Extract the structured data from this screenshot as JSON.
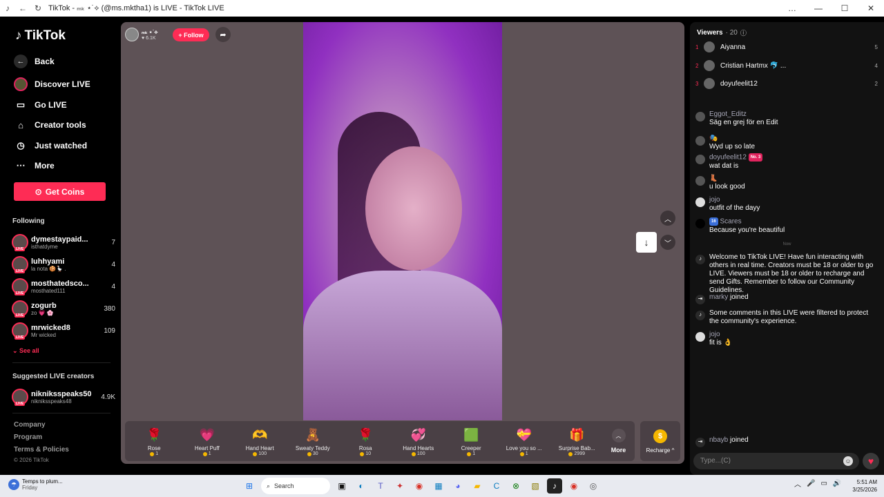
{
  "window": {
    "title": "TikTok - ₘₖ ⋆˙⟡ (@ms.mktha1) is LIVE - TikTok LIVE",
    "controls": [
      "…",
      "—",
      "☐",
      "✕"
    ]
  },
  "sidebar": {
    "logo_text": "TikTok",
    "back_label": "Back",
    "nav": [
      {
        "label": "Discover LIVE",
        "icon": "avatar-live-icon"
      },
      {
        "label": "Go LIVE",
        "icon": "camera-icon"
      },
      {
        "label": "Creator tools",
        "icon": "house-icon"
      },
      {
        "label": "Just watched",
        "icon": "clock-icon"
      },
      {
        "label": "More",
        "icon": "more-dots-icon"
      }
    ],
    "coins_label": "Get Coins",
    "following_title": "Following",
    "following": [
      {
        "name": "dymestaypaid...",
        "sub": "isthatdyme",
        "count": "7"
      },
      {
        "name": "luhhyami",
        "sub": "la nota 🍪🪿 .",
        "count": "4"
      },
      {
        "name": "mosthatedsco...",
        "sub": "mosthated111",
        "count": "4"
      },
      {
        "name": "zogurb",
        "sub": "zo 💗 🌸",
        "count": "380"
      },
      {
        "name": "mrwicked8",
        "sub": "Mr wicked",
        "count": "109"
      }
    ],
    "see_all": "See all",
    "suggested_title": "Suggested LIVE creators",
    "suggested": [
      {
        "name": "nikniksspeaks50",
        "sub": "nikniksspeaks48",
        "count": "4.9K"
      }
    ],
    "footer_links": [
      "Company",
      "Program",
      "Terms & Policies"
    ],
    "copyright": "© 2026 TikTok"
  },
  "stage": {
    "host_name": "ₘₖ ⋆˙⟡",
    "host_likes": "♥ 6.1K",
    "follow_label": "+ Follow",
    "gifts": [
      {
        "name": "Rose",
        "price": "1",
        "emoji": "🌹"
      },
      {
        "name": "Heart Puff",
        "price": "1",
        "emoji": "💗"
      },
      {
        "name": "Hand Heart",
        "price": "100",
        "emoji": "🫶"
      },
      {
        "name": "Sweaty Teddy",
        "price": "30",
        "emoji": "🧸"
      },
      {
        "name": "Rosa",
        "price": "10",
        "emoji": "🌹"
      },
      {
        "name": "Hand Hearts",
        "price": "100",
        "emoji": "💞"
      },
      {
        "name": "Creeper",
        "price": "1",
        "emoji": "🟩"
      },
      {
        "name": "Love you so ...",
        "price": "1",
        "emoji": "💝"
      },
      {
        "name": "Surprise Bab...",
        "price": "2999",
        "emoji": "🎁"
      }
    ],
    "more_label": "More",
    "recharge_label": "Recharge ^"
  },
  "chat": {
    "viewers_title": "Viewers",
    "viewers_count": "· 20",
    "viewers": [
      {
        "rank": "1",
        "name": "Aiyanna",
        "score": "5"
      },
      {
        "rank": "2",
        "name": "Cristian Hartmx 🐬 ...",
        "score": "4"
      },
      {
        "rank": "3",
        "name": "doyufeelit12",
        "score": "2"
      }
    ],
    "messages": [
      {
        "user": "Eggot_Editz",
        "text": "Säg en grej för en Edit"
      },
      {
        "user": "🎭",
        "text": "Wyd up so late"
      },
      {
        "user": "doyufeelit12",
        "badge": "No. 3",
        "text": "wat dat is"
      },
      {
        "user": "👢",
        "text": "u look good"
      },
      {
        "user": "jojo",
        "text": "outfit of the dayy"
      },
      {
        "user": "Scares",
        "badge": "16",
        "text": "Because you're beautiful"
      }
    ],
    "now_label": "Now",
    "system_messages": [
      {
        "text": "Welcome to TikTok LIVE! Have fun interacting with others in real time. Creators must be 18 or older to go LIVE. Viewers must be 18 or older to recharge and send Gifts. Remember to follow our Community Guidelines."
      },
      {
        "user": "marky",
        "text": "joined"
      },
      {
        "text": "Some comments in this LIVE were filtered to protect the community's experience."
      },
      {
        "user": "jojo",
        "text": "fit is 👌"
      }
    ],
    "last_join": {
      "user": "nbayb",
      "text": "joined"
    },
    "input_placeholder": "Type...(C)"
  },
  "taskbar": {
    "weather_line1": "Temps to plum...",
    "weather_line2": "Friday",
    "search_label": "Search",
    "time": "5:51 AM",
    "date": "3/25/2026"
  }
}
